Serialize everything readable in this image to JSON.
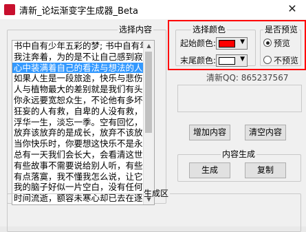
{
  "window": {
    "title": "清新_论坛渐变字生成器_Beta",
    "close_glyph": "✕"
  },
  "input_section": {
    "legend": "选择内容",
    "lines": [
      {
        "text": "书中自有少年五彩的梦; 书中自有年",
        "selected": false
      },
      {
        "text": "我注奔着，为的是不让自己感到寂寞",
        "selected": false
      },
      {
        "text": "心中装满着自己的看法与想法的人",
        "selected": true
      },
      {
        "text": "如果人生是一段旅途，快乐与悲伤就",
        "selected": false
      },
      {
        "text": "人与植物最大的差别就是我们有头脑",
        "selected": false
      },
      {
        "text": "你永远要宽恕众生，不论他有多坏，",
        "selected": false
      },
      {
        "text": "狂妄的人有救，自卑的人没有救，认",
        "selected": false
      },
      {
        "text": "浮华一生，淡忘一季。空有回忆，扎",
        "selected": false
      },
      {
        "text": "放弃该放弃的是成长，放弃不该放弃",
        "selected": false
      },
      {
        "text": "当你快乐时，你要想这快乐不是永恒",
        "selected": false
      },
      {
        "text": "总有一天我们会长大，会看清这世间",
        "selected": false
      },
      {
        "text": "有些故事不需要说给别人听，有些悲",
        "selected": false
      },
      {
        "text": "有点落寞，我不懂我怎么说，让它在",
        "selected": false
      },
      {
        "text": "我的脑子好似一片空白，没有任何思",
        "selected": false
      },
      {
        "text": "时间流逝，额容未寒心却已去在逐",
        "selected": false
      }
    ]
  },
  "color_section": {
    "legend": "选择颜色",
    "start_label": "起始颜色:",
    "start_color": "#ff0000",
    "end_label": "末尾颜色:",
    "end_color": "#ffffff",
    "dropdown_glyph": "▼"
  },
  "preview_section": {
    "legend": "是否预览",
    "options": [
      {
        "label": "预览",
        "checked": true
      },
      {
        "label": "不预览",
        "checked": false
      }
    ]
  },
  "qq_text": "清新QQ: 865237567",
  "buttons": {
    "add_content": "增加内容",
    "clear_content": "清空内容",
    "generate": "生成",
    "copy": "复制"
  },
  "generate_section": {
    "legend": "内容生成"
  },
  "output_section": {
    "legend": "生成区"
  },
  "accent": {
    "highlight_box": "#ff0000",
    "selection": "#3399ff"
  }
}
